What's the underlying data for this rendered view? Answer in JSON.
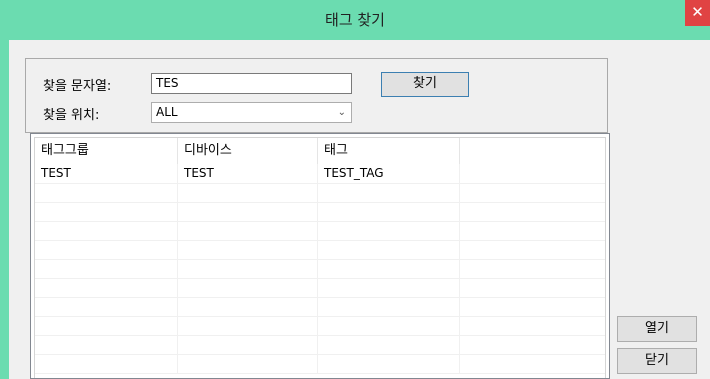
{
  "window": {
    "title": "태그 찾기",
    "close_glyph": "✕"
  },
  "search": {
    "find_text_label": "찾을 문자열:",
    "find_text_value": "TES",
    "location_label": "찾을 위치:",
    "location_value": "ALL",
    "find_button": "찾기"
  },
  "table": {
    "columns": [
      "태그그룹",
      "디바이스",
      "태그",
      ""
    ],
    "rows": [
      [
        "TEST",
        "TEST",
        "TEST_TAG",
        ""
      ]
    ]
  },
  "buttons": {
    "open": "열기",
    "close": "닫기"
  }
}
